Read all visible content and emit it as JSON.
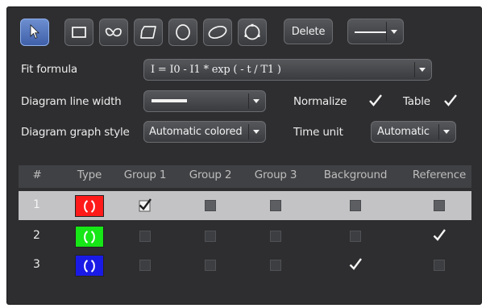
{
  "toolbar": {
    "tools": [
      {
        "icon": "pointer-icon",
        "active": true
      },
      {
        "icon": "rectangle-icon",
        "active": false
      },
      {
        "icon": "freehand-icon",
        "active": false
      },
      {
        "icon": "polygon-icon",
        "active": false
      },
      {
        "icon": "circle-icon",
        "active": false
      },
      {
        "icon": "ellipse-icon",
        "active": false
      },
      {
        "icon": "circle-points-icon",
        "active": false
      }
    ],
    "delete_label": "Delete",
    "line_style_icon": "line-style-icon"
  },
  "fit_formula": {
    "label": "Fit formula",
    "value": "I = I0 - I1 * exp ( - t / T1 )"
  },
  "line_width": {
    "label": "Diagram line width",
    "value_icon": "thick-line-icon"
  },
  "normalize": {
    "label": "Normalize",
    "checked": true
  },
  "table_opt": {
    "label": "Table",
    "checked": true
  },
  "graph_style": {
    "label": "Diagram graph style",
    "value": "Automatic colored"
  },
  "time_unit": {
    "label": "Time unit",
    "value": "Automatic"
  },
  "table": {
    "headers": [
      "#",
      "Type",
      "Group 1",
      "Group 2",
      "Group 3",
      "Background",
      "Reference"
    ],
    "rows": [
      {
        "num": "1",
        "type_icon": "circle-region-icon",
        "color": "#ff1a1a",
        "selected": true,
        "group1": true,
        "group2": false,
        "group3": false,
        "background": false,
        "reference": false
      },
      {
        "num": "2",
        "type_icon": "circle-region-icon",
        "color": "#17e617",
        "selected": false,
        "group1": false,
        "group2": false,
        "group3": false,
        "background": false,
        "reference": true
      },
      {
        "num": "3",
        "type_icon": "circle-region-icon",
        "color": "#1a1ae6",
        "selected": false,
        "group1": false,
        "group2": false,
        "group3": false,
        "background": true,
        "reference": false
      }
    ]
  }
}
